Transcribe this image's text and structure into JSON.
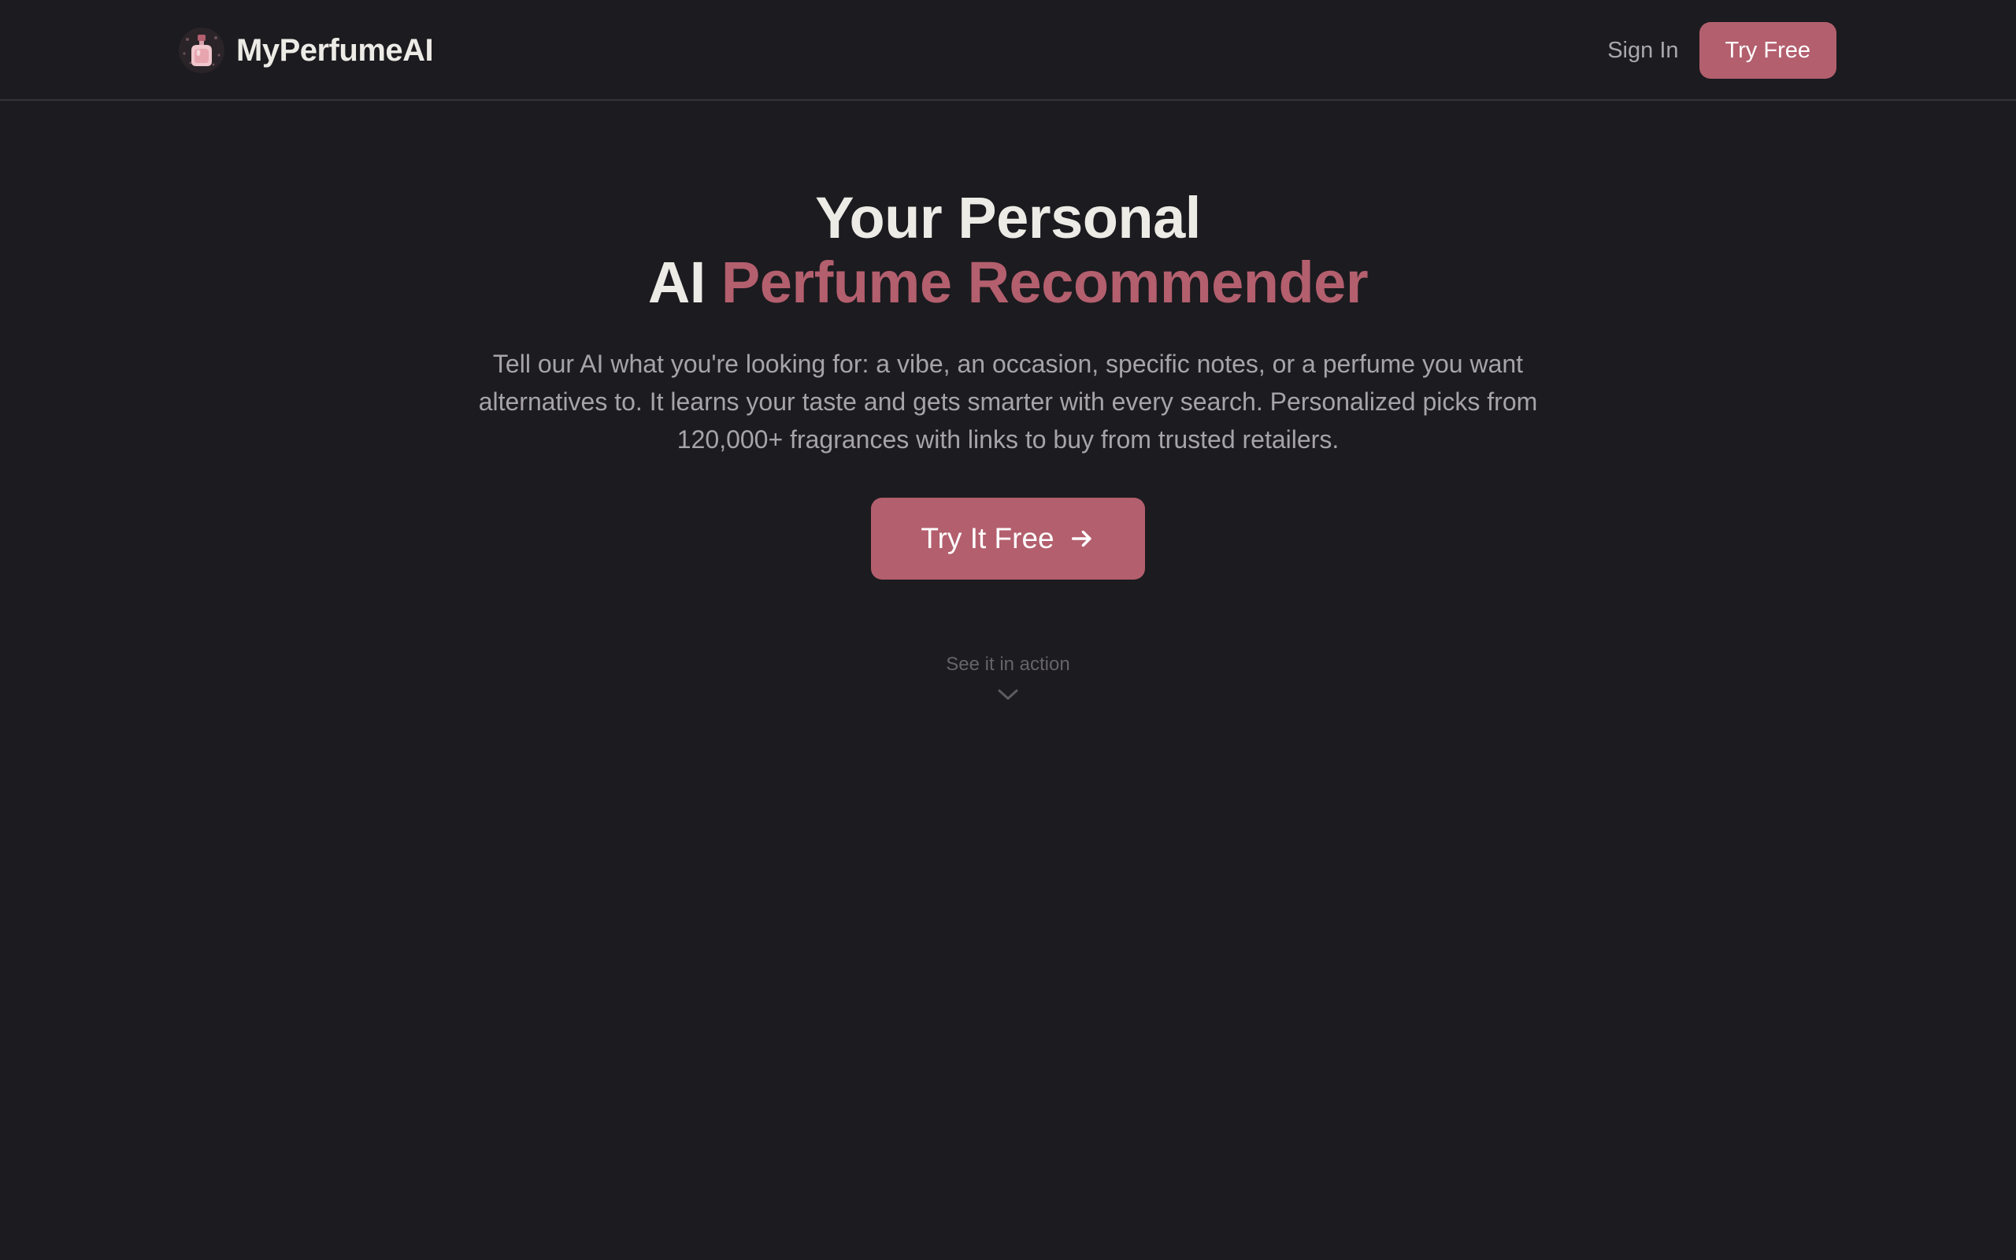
{
  "header": {
    "brand_name": "MyPerfumeAI",
    "sign_in_label": "Sign In",
    "try_free_label": "Try Free"
  },
  "hero": {
    "title_line1": "Your Personal",
    "title_line2_plain": "AI",
    "title_line2_accent": "Perfume Recommender",
    "subtitle": "Tell our AI what you're looking for: a vibe, an occasion, specific notes, or a perfume you want alternatives to. It learns your taste and gets smarter with every search. Personalized picks from 120,000+ fragrances with links to buy from trusted retailers.",
    "cta_label": "Try It Free",
    "see_action_label": "See it in action"
  },
  "icons": {
    "logo": "perfume-bottle-icon",
    "cta_arrow": "arrow-right-icon",
    "scroll": "chevron-down-icon"
  },
  "colors": {
    "background": "#1c1b1f",
    "accent": "#b35f6e",
    "text_primary": "#ecebe6",
    "text_muted": "#a6a4a8"
  }
}
